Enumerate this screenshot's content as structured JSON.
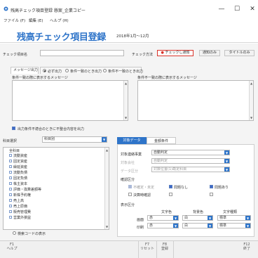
{
  "window": {
    "title": "残高チェック項目登録 懸案_企業コピー",
    "min": "—",
    "max": "☐",
    "close": "✕"
  },
  "menu": [
    {
      "label": "ファイル (F)"
    },
    {
      "label": "編集 (E)"
    },
    {
      "label": "ヘルプ (H)"
    }
  ],
  "header": {
    "title": "残高チェック項目登録",
    "period": "2018年1月～12月"
  },
  "search": {
    "label": "チェック項目名",
    "value": "",
    "method_label": "チェック方法"
  },
  "method_buttons": [
    {
      "label": "チェックし通知",
      "active": true
    },
    {
      "label": "通知のみ"
    },
    {
      "label": "タイトルのみ"
    }
  ],
  "message_tabs": [
    {
      "label": "メッセージ出力",
      "active": true
    },
    {
      "label": "必ず出力"
    },
    {
      "label": "条件一致のとき出力"
    },
    {
      "label": "条件不一致のとき出力"
    }
  ],
  "messages": {
    "match_label": "条件一致の際に表示するメッセージ",
    "nomatch_label": "条件不一致の際に表示するメッセージ"
  },
  "output_check": {
    "label": "出力条件不適合のときに不整合内容を出力"
  },
  "subject": {
    "label": "科目選択",
    "value": "科目別"
  },
  "tree": [
    {
      "label": "全科目",
      "level": 0
    },
    {
      "label": "流動資産",
      "level": 1
    },
    {
      "label": "固定資産",
      "level": 1
    },
    {
      "label": "繰延資産",
      "level": 1
    },
    {
      "label": "流動負債",
      "level": 1
    },
    {
      "label": "固定負債",
      "level": 1
    },
    {
      "label": "株主資本",
      "level": 1
    },
    {
      "label": "評価・換算差額等",
      "level": 1
    },
    {
      "label": "新株予約権",
      "level": 1
    },
    {
      "label": "売上高",
      "level": 1
    },
    {
      "label": "売上原価",
      "level": 1
    },
    {
      "label": "販売管理費",
      "level": 1
    },
    {
      "label": "営業外損益",
      "level": 1
    }
  ],
  "tree_footer": {
    "label": "検索コードの表示"
  },
  "right_tabs": [
    {
      "label": "対象データ",
      "active": true
    },
    {
      "label": "金額条件"
    }
  ],
  "target": {
    "label": "対象連絡事業",
    "value": "自動判定",
    "rows": [
      {
        "label": "対象会社",
        "value": "自動判定"
      },
      {
        "label": "データ区分",
        "value": "対数位置(1)勘定科目"
      }
    ]
  },
  "confirm": {
    "label": "確認区分",
    "options": [
      {
        "label": "不確定・未定",
        "checked": true,
        "disabled": true
      },
      {
        "label": "問題なし",
        "checked": true
      },
      {
        "label": "問題あり",
        "checked": true
      },
      {
        "label": "決算時確認",
        "checked": false
      },
      {
        "label": "",
        "checked": false
      },
      {
        "label": "",
        "checked": false
      }
    ]
  },
  "display": {
    "label": "表示区分",
    "headers": [
      "文字色",
      "背景色",
      "文字種類"
    ],
    "rows": [
      {
        "label": "画面",
        "color": "赤",
        "bg": "白",
        "style": "標準"
      },
      {
        "label": "印刷",
        "color": "赤",
        "bg": "白",
        "style": "標準"
      }
    ]
  },
  "footer": [
    {
      "key": "F1",
      "label": "ヘルプ"
    },
    {
      "key": "F7",
      "label": "リセット"
    },
    {
      "key": "F8",
      "label": "登録"
    },
    {
      "key": "F12",
      "label": "終了"
    }
  ],
  "colors": {
    "accent": "#2e74c9",
    "active_border": "#d9342b"
  }
}
